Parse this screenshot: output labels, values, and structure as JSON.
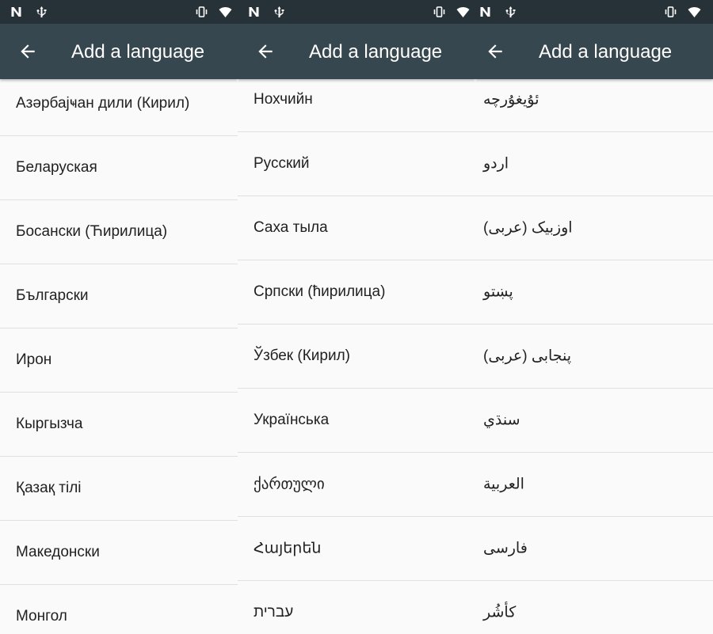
{
  "colors": {
    "status_bar": "#263238",
    "toolbar": "#37474f",
    "background": "#fafafa",
    "divider": "#e0e0e0"
  },
  "status_icons": [
    "nfc-n-icon",
    "usb-icon",
    "vibrate-icon",
    "wifi-icon"
  ],
  "panels": [
    {
      "title": "Add a language",
      "items": [
        {
          "label": "Азәрбајҹан дили (Кирил)"
        },
        {
          "label": "Беларуская"
        },
        {
          "label": "Босански (Ћирилица)"
        },
        {
          "label": "Български"
        },
        {
          "label": "Ирон"
        },
        {
          "label": "Кыргызча"
        },
        {
          "label": "Қазақ тілі"
        },
        {
          "label": "Македонски"
        },
        {
          "label": "Монгол"
        }
      ]
    },
    {
      "title": "Add a language",
      "items": [
        {
          "label": "Нохчийн"
        },
        {
          "label": "Русский"
        },
        {
          "label": "Саха тыла"
        },
        {
          "label": "Српски (ћирилица)"
        },
        {
          "label": "Ўзбек (Кирил)"
        },
        {
          "label": "Українська"
        },
        {
          "label": "ქართული"
        },
        {
          "label": "Հայերեն"
        },
        {
          "label": "עברית"
        }
      ]
    },
    {
      "title": "Add a language",
      "items": [
        {
          "label": "ئۇيغۇرچە"
        },
        {
          "label": "اردو"
        },
        {
          "label": "اوزبیک (عربی)"
        },
        {
          "label": "پښتو"
        },
        {
          "label": "پنجابی (عربی)"
        },
        {
          "label": "سنڌي"
        },
        {
          "label": "العربية"
        },
        {
          "label": "فارسی"
        },
        {
          "label": "کأشُر"
        }
      ]
    }
  ]
}
